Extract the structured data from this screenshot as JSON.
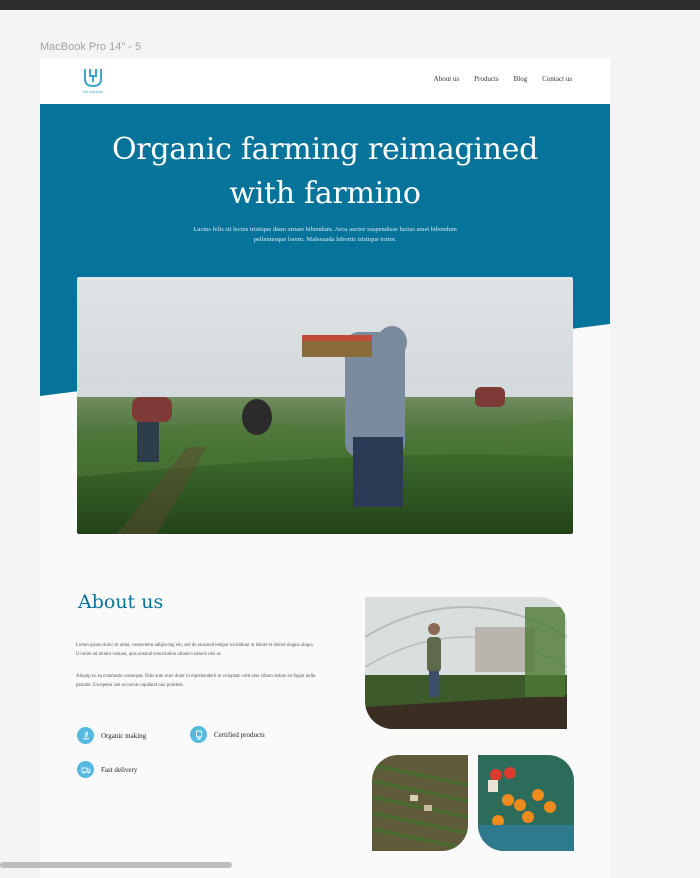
{
  "frame": {
    "label": "MacBook Pro 14\" - 5"
  },
  "nav": {
    "logo_text": "the supplier",
    "links": [
      "About us",
      "Products",
      "Blog",
      "Contact us"
    ]
  },
  "hero": {
    "title_line1": "Organic farming reimagined",
    "title_line2": "with farmino",
    "subtitle": "Luctus felis sit lectus tristique diam ornare bibendum. Arcu auctor suspendisse luctus amet bibendum pellentesque lorem. Malesuada lobortis tristique tortor."
  },
  "about": {
    "title": "About us",
    "paragraph1": "Lorem ipsum dolor sit amet, consectetur adipiscing elit, sed do eiusmod tempor incididunt ut labore et dolore magna aliqua. Ut enim ad minim veniam, quis nostrud exercitation ullamco laboris nisi ut.",
    "paragraph2": "Aliquip ex ea commodo consequat. Duis aute irure dolor in reprehenderit in voluptate velit esse cillum dolore eu fugiat nulla pariatur. Excepteur sint occaecat cupidatat non proident.",
    "features": [
      "Organic making",
      "Certified products",
      "Fast delivery"
    ]
  },
  "colors": {
    "primary": "#06739a",
    "accent": "#55b9e0",
    "background": "#fafafa"
  },
  "icons": [
    "logo-icon",
    "leaf-hand-icon",
    "certificate-icon",
    "delivery-truck-icon"
  ]
}
